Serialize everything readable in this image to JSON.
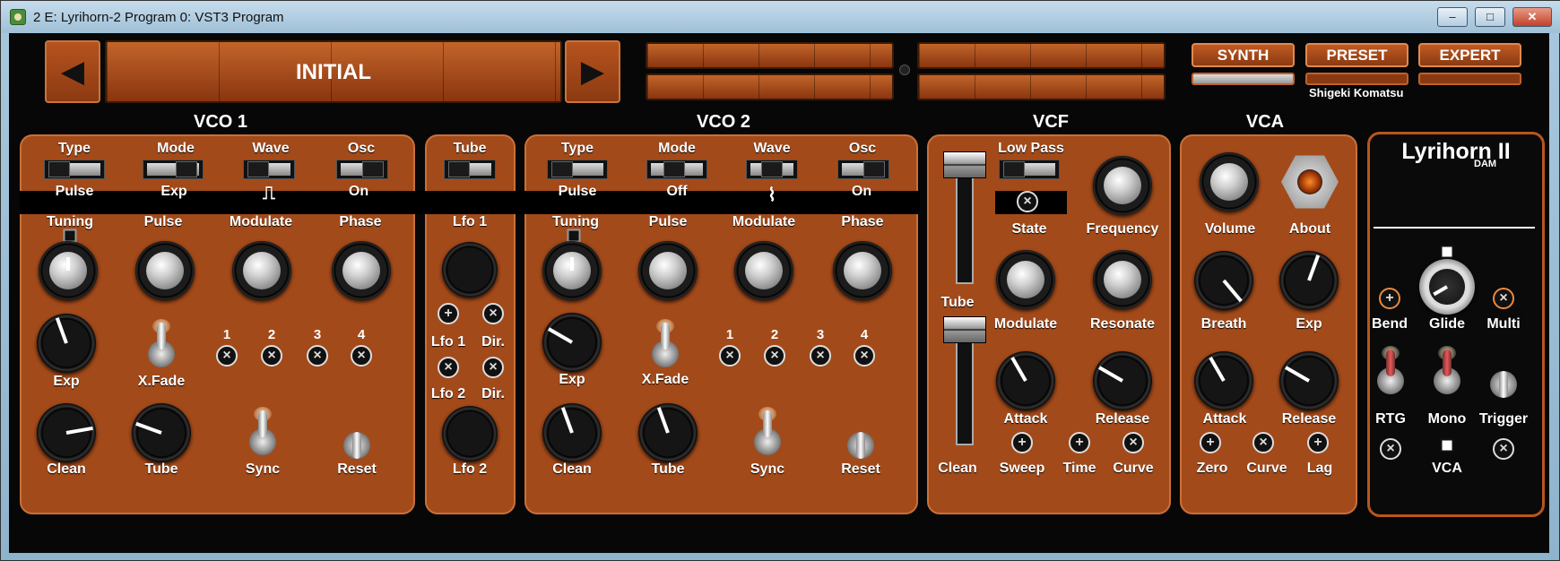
{
  "window": {
    "title": "2 E: Lyrihorn-2 Program 0: VST3 Program",
    "minimize": "–",
    "maximize": "□",
    "close": "✕"
  },
  "topbar": {
    "prev_icon": "◀",
    "next_icon": "▶",
    "patch_name": "INITIAL",
    "tabs": [
      "SYNTH",
      "PRESET",
      "EXPERT"
    ],
    "author": "Shigeki Komatsu"
  },
  "sections": {
    "vco1": "VCO 1",
    "vco2": "VCO 2",
    "vcf": "VCF",
    "vca": "VCA"
  },
  "vco1": {
    "switch_labels": [
      "Type",
      "Mode",
      "Wave",
      "Osc"
    ],
    "switch_values": [
      "Pulse",
      "Exp",
      "⎍",
      "On"
    ],
    "knob_labels": [
      "Tuning",
      "Pulse",
      "Modulate",
      "Phase"
    ],
    "exp": "Exp",
    "xfade": "X.Fade",
    "numbers": [
      "1",
      "2",
      "3",
      "4"
    ],
    "clean": "Clean",
    "tube": "Tube",
    "sync": "Sync",
    "reset": "Reset"
  },
  "tube": {
    "title": "Tube",
    "lfo1": "Lfo 1",
    "lfo1_label": "Lfo 1",
    "dir1": "Dir.",
    "lfo2_label": "Lfo 2",
    "dir2": "Dir.",
    "lfo2": "Lfo 2"
  },
  "vco2": {
    "switch_labels": [
      "Type",
      "Mode",
      "Wave",
      "Osc"
    ],
    "switch_values": [
      "Pulse",
      "Off",
      "⌇",
      "On"
    ],
    "knob_labels": [
      "Tuning",
      "Pulse",
      "Modulate",
      "Phase"
    ],
    "exp": "Exp",
    "xfade": "X.Fade",
    "numbers": [
      "1",
      "2",
      "3",
      "4"
    ],
    "clean": "Clean",
    "tube": "Tube",
    "sync": "Sync",
    "reset": "Reset"
  },
  "vcf": {
    "filter": "Low Pass",
    "state": "State",
    "frequency": "Frequency",
    "tube": "Tube",
    "modulate": "Modulate",
    "resonate": "Resonate",
    "attack": "Attack",
    "release": "Release",
    "clean": "Clean",
    "sweep": "Sweep",
    "time": "Time",
    "curve": "Curve"
  },
  "vca": {
    "volume": "Volume",
    "about": "About",
    "breath": "Breath",
    "exp": "Exp",
    "attack": "Attack",
    "release": "Release",
    "zero": "Zero",
    "curve": "Curve",
    "lag": "Lag"
  },
  "brand": {
    "name": "Lyrihorn II",
    "sub": "DAM",
    "bend": "Bend",
    "glide": "Glide",
    "multi": "Multi",
    "rtg": "RTG",
    "mono": "Mono",
    "trigger": "Trigger",
    "vca": "VCA"
  }
}
